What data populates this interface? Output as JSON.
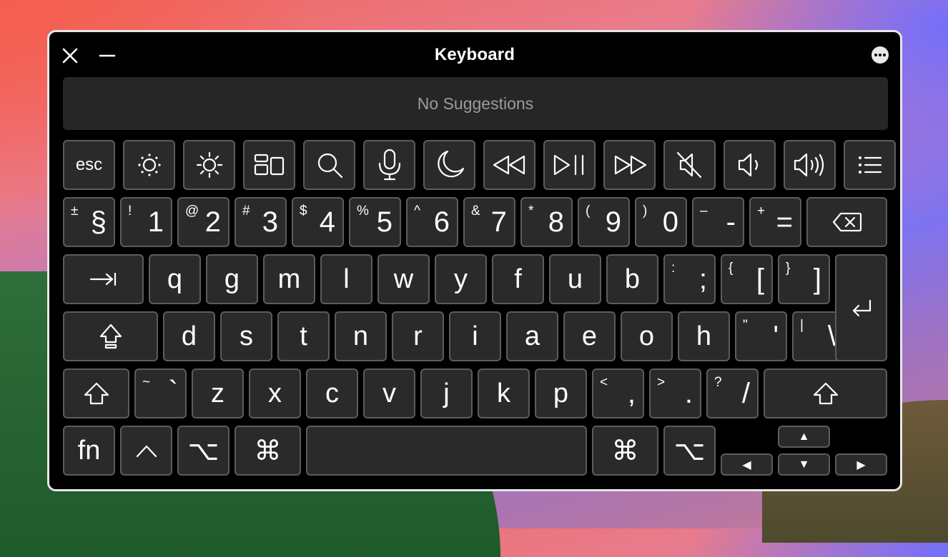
{
  "window": {
    "title": "Keyboard"
  },
  "suggestions": {
    "text": "No Suggestions"
  },
  "function_row": [
    {
      "label": "esc",
      "icon": "esc"
    },
    {
      "label": "",
      "icon": "brightness-down-icon"
    },
    {
      "label": "",
      "icon": "brightness-up-icon"
    },
    {
      "label": "",
      "icon": "mission-control-icon"
    },
    {
      "label": "",
      "icon": "search-icon"
    },
    {
      "label": "",
      "icon": "microphone-icon"
    },
    {
      "label": "",
      "icon": "moon-icon"
    },
    {
      "label": "",
      "icon": "rewind-icon"
    },
    {
      "label": "",
      "icon": "play-pause-icon"
    },
    {
      "label": "",
      "icon": "fast-forward-icon"
    },
    {
      "label": "",
      "icon": "mute-icon"
    },
    {
      "label": "",
      "icon": "volume-down-icon"
    },
    {
      "label": "",
      "icon": "volume-up-icon"
    },
    {
      "label": "",
      "icon": "list-icon"
    }
  ],
  "number_row": [
    {
      "shift": "±",
      "main": "§"
    },
    {
      "shift": "!",
      "main": "1"
    },
    {
      "shift": "@",
      "main": "2"
    },
    {
      "shift": "#",
      "main": "3"
    },
    {
      "shift": "$",
      "main": "4"
    },
    {
      "shift": "%",
      "main": "5"
    },
    {
      "shift": "^",
      "main": "6"
    },
    {
      "shift": "&",
      "main": "7"
    },
    {
      "shift": "*",
      "main": "8"
    },
    {
      "shift": "(",
      "main": "9"
    },
    {
      "shift": ")",
      "main": "0"
    },
    {
      "shift": "–",
      "main": "-"
    },
    {
      "shift": "+",
      "main": "="
    }
  ],
  "row_q": [
    "q",
    "g",
    "m",
    "l",
    "w",
    "y",
    "f",
    "u",
    "b"
  ],
  "row_q_symbols": [
    {
      "shift": ":",
      "main": ";"
    },
    {
      "shift": "{",
      "main": "["
    },
    {
      "shift": "}",
      "main": "]"
    }
  ],
  "row_a": [
    "d",
    "s",
    "t",
    "n",
    "r",
    "i",
    "a",
    "e",
    "o",
    "h"
  ],
  "row_a_symbols": [
    {
      "shift": "\"",
      "main": "'"
    },
    {
      "shift": "|",
      "main": "\\"
    }
  ],
  "row_z_tilde": {
    "shift": "~",
    "main": "`"
  },
  "row_z": [
    "z",
    "x",
    "c",
    "v",
    "j",
    "k",
    "p"
  ],
  "row_z_symbols": [
    {
      "shift": "<",
      "main": ","
    },
    {
      "shift": ">",
      "main": "."
    },
    {
      "shift": "?",
      "main": "/"
    }
  ],
  "bottom_row": {
    "fn": "fn",
    "control": "^",
    "option": "⌥",
    "command": "⌘",
    "command_right": "⌘",
    "option_right": "⌥",
    "arrow_up": "▲",
    "arrow_left": "◀",
    "arrow_down": "▼",
    "arrow_right": "▶"
  }
}
